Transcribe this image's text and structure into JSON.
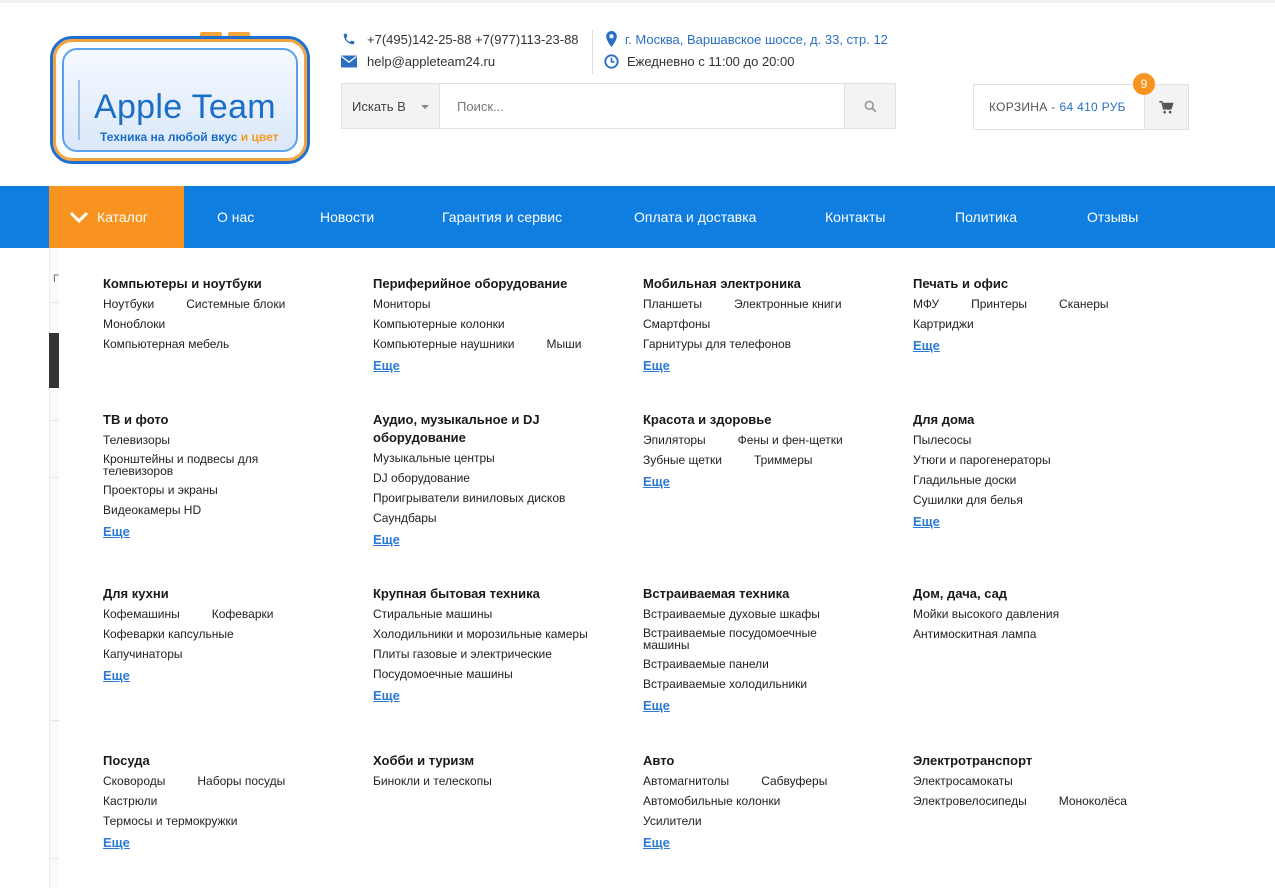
{
  "header": {
    "logo_title": "Apple Team",
    "logo_sub_main": "Техника на любой вкус",
    "logo_sub_accent": "и цвет",
    "phones": "+7(495)142-25-88 +7(977)113-23-88",
    "email": "help@appleteam24.ru",
    "address": "г. Москва, Варшавское шоссе, д. 33, стр. 12",
    "hours": "Ежедневно с 11:00 до 20:00"
  },
  "search": {
    "scope_label": "Искать В",
    "placeholder": "Поиск..."
  },
  "cart": {
    "label": "КОРЗИНА -",
    "sum": "64 410 РУБ",
    "count": "9"
  },
  "nav": {
    "catalog": "Каталог",
    "items": [
      "О нас",
      "Новости",
      "Гарантия и сервис",
      "Оплата и доставка",
      "Контакты",
      "Политика",
      "Отзывы"
    ]
  },
  "side": {
    "glyph": "Г"
  },
  "more_label": "Еще",
  "categories": [
    {
      "title": "Компьютеры и ноутбуки",
      "links": [
        "Ноутбуки",
        "Системные блоки",
        "Моноблоки",
        "Компьютерная мебель"
      ],
      "more": true
    },
    {
      "title": "Периферийное оборудование",
      "links": [
        "Мониторы",
        "Компьютерные колонки",
        "Компьютерные наушники",
        "Мыши"
      ],
      "more": true
    },
    {
      "title": "Мобильная электроника",
      "links": [
        "Планшеты",
        "Электронные книги",
        "Смартфоны",
        "Гарнитуры для телефонов"
      ],
      "more": true
    },
    {
      "title": "Печать и офис",
      "links": [
        "МФУ",
        "Принтеры",
        "Сканеры",
        "Картриджи"
      ],
      "more": true
    },
    {
      "title": "ТВ и фото",
      "links": [
        "Телевизоры",
        "Кронштейны и подвесы для телевизоров",
        "Проекторы и экраны",
        "Видеокамеры HD"
      ],
      "more": true
    },
    {
      "title": "Аудио, музыкальное и DJ оборудование",
      "links": [
        "Музыкальные центры",
        "DJ оборудование",
        "Проигрыватели виниловых дисков",
        "Саундбары"
      ],
      "more": true
    },
    {
      "title": "Красота и здоровье",
      "links": [
        "Эпиляторы",
        "Фены и фен-щетки",
        "Зубные щетки",
        "Триммеры"
      ],
      "more": true
    },
    {
      "title": "Для дома",
      "links": [
        "Пылесосы",
        "Утюги и парогенераторы",
        "Гладильные доски",
        "Сушилки для белья"
      ],
      "more": true
    },
    {
      "title": "Для кухни",
      "links": [
        "Кофемашины",
        "Кофеварки",
        "Кофеварки капсульные",
        "Капучинаторы"
      ],
      "more": true
    },
    {
      "title": "Крупная бытовая техника",
      "links": [
        "Стиральные машины",
        "Холодильники и морозильные камеры",
        "Плиты газовые и электрические",
        "Посудомоечные машины"
      ],
      "more": true
    },
    {
      "title": "Встраиваемая техника",
      "links": [
        "Встраиваемые духовые шкафы",
        "Встраиваемые посудомоечные машины",
        "Встраиваемые панели",
        "Встраиваемые холодильники"
      ],
      "more": true
    },
    {
      "title": "Дом, дача, сад",
      "links": [
        "Мойки высокого давления",
        "Антимоскитная лампа"
      ],
      "more": false
    },
    {
      "title": "Посуда",
      "links": [
        "Сковороды",
        "Наборы посуды",
        "Кастрюли",
        "Термосы и термокружки"
      ],
      "more": true
    },
    {
      "title": "Хобби и туризм",
      "links": [
        "Бинокли и телескопы"
      ],
      "more": false
    },
    {
      "title": "Авто",
      "links": [
        "Автомагнитолы",
        "Сабвуферы",
        "Автомобильные колонки",
        "Усилители"
      ],
      "more": true
    },
    {
      "title": "Электротранспорт",
      "links": [
        "Электросамокаты",
        "Электровелосипеды",
        "Моноколёса"
      ],
      "more": false
    }
  ],
  "colors": {
    "accent_blue": "#0f7ee0",
    "accent_orange": "#f7931e",
    "link_blue": "#2b7ad6"
  }
}
